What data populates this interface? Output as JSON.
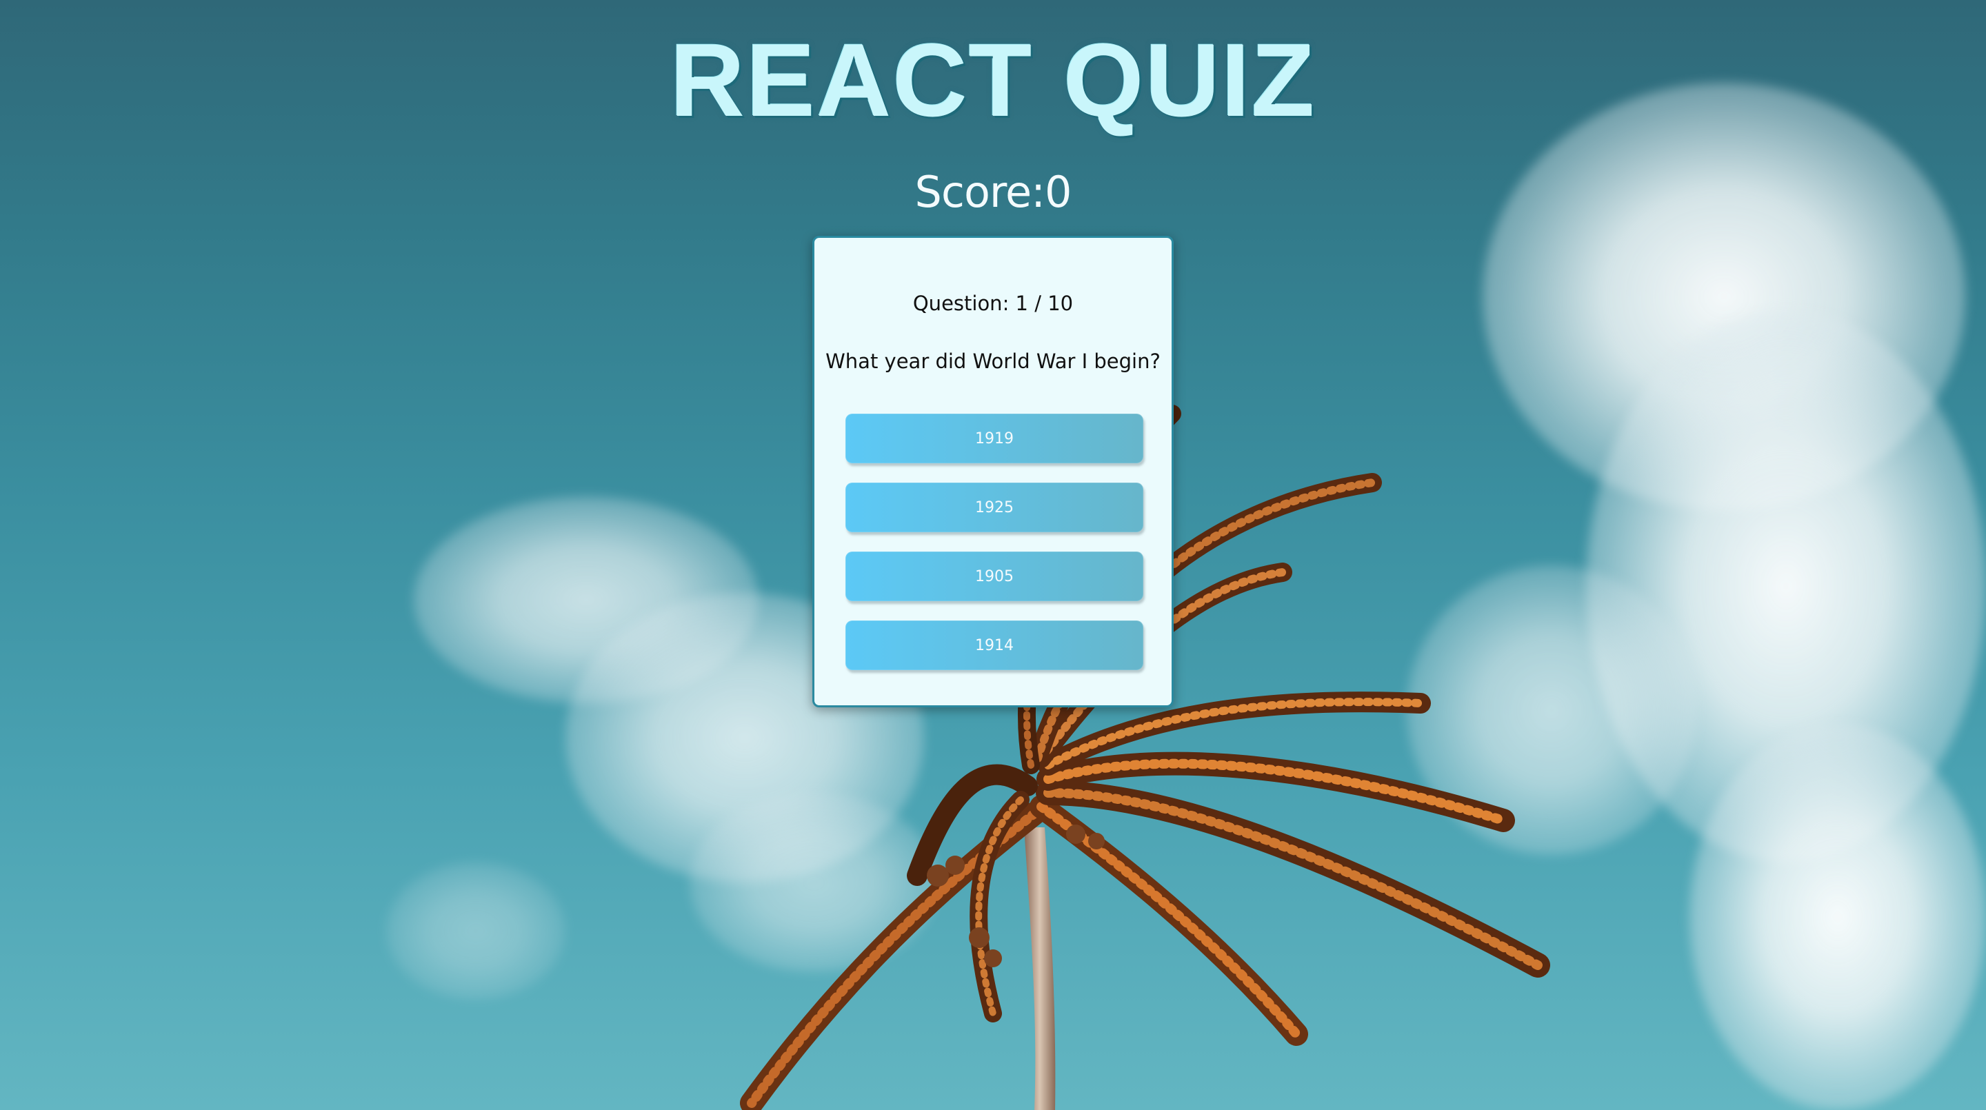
{
  "app": {
    "title": "REACT QUIZ",
    "score_label": "Score:0"
  },
  "quiz": {
    "question_counter": "Question: 1 / 10",
    "question_text": "What year did World War I begin?",
    "answers": [
      "1919",
      "1925",
      "1905",
      "1914"
    ]
  },
  "colors": {
    "title": "#c9f6fb",
    "card_bg": "#ebfbfd",
    "card_border": "#2a8aa0",
    "button_gradient_start": "#5cc9f6",
    "button_gradient_end": "#66b6cb"
  }
}
